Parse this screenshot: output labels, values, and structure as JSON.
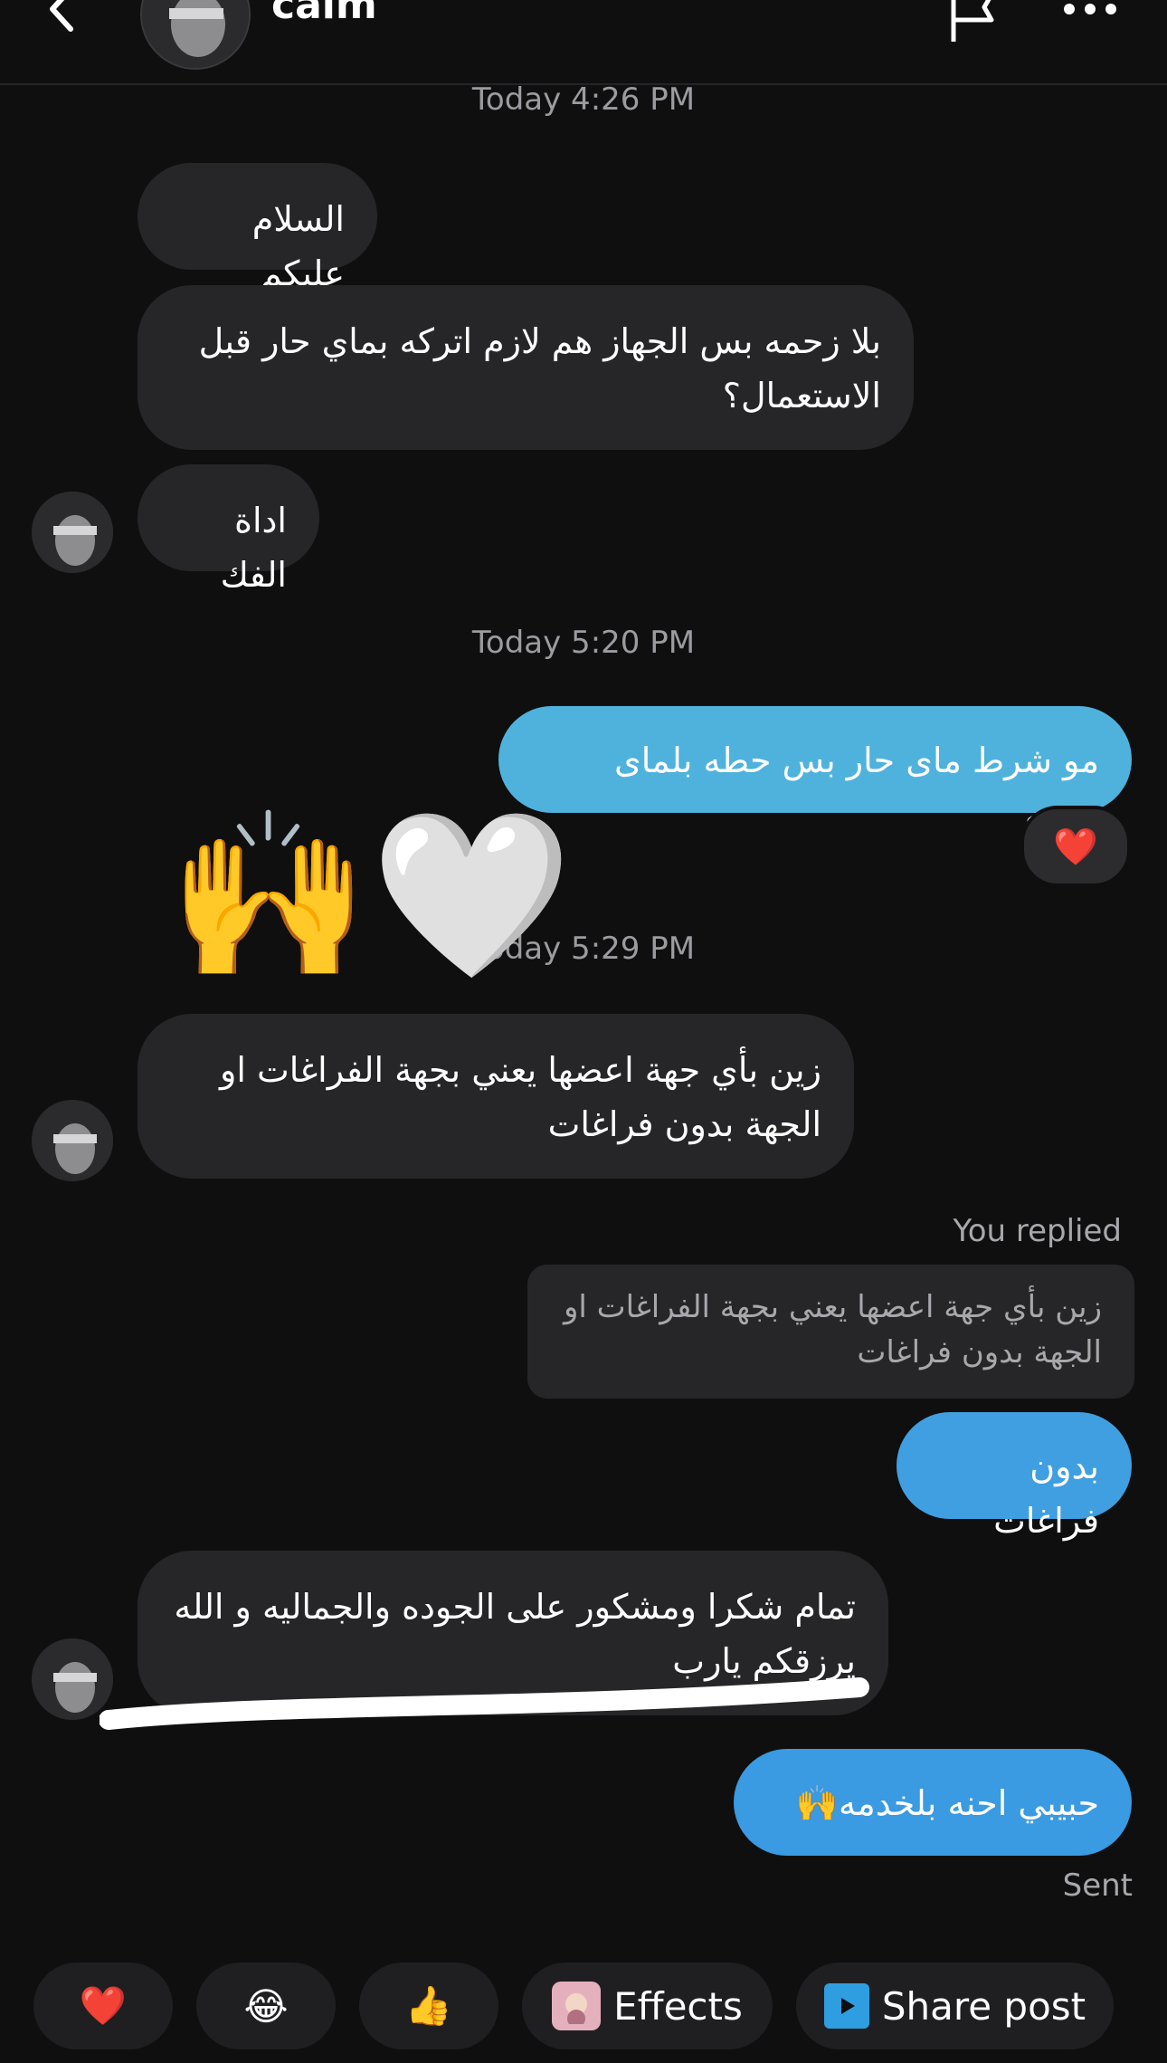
{
  "header": {
    "contact_name": "calm"
  },
  "timestamps": {
    "t1": "Today 4:26 PM",
    "t2": "Today 5:20 PM",
    "t3": "Today 5:29 PM"
  },
  "messages": {
    "m1": "السلام عليكم",
    "m2": "بلا زحمه بس الجهاز هم لازم اتركه بماي حار قبل الاستعمال؟",
    "m3": "اداة الفك",
    "m4": "مو شرط ماى حار بس حطه بلماى شويه",
    "m5": "زين بأي جهة اعضها يعني بجهة الفراغات او الجهة بدون فراغات",
    "m6": "بدون فراغات",
    "m7": "تمام شكرا ومشكور على الجوده والجماليه و الله يرزقكم يارب",
    "m8": "حبيبي احنه بلخدمه🙌"
  },
  "reaction_emoji": "❤️",
  "overlay_emojis": "🙌🤍",
  "you_replied_label": "You replied",
  "reply_quote_text": "زين بأي جهة اعضها يعني بجهة الفراغات او الجهة بدون فراغات",
  "sent_label": "Sent",
  "quick_actions": {
    "heart": "❤️",
    "laugh": "😂",
    "thumbs": "👍",
    "effects_label": "Effects",
    "share_label": "Share post"
  },
  "colors": {
    "background": "#0f0f10",
    "incoming_bubble": "#262628",
    "outgoing_bubble": "#4fb2dd",
    "outgoing_bubble_dark": "#3a9ae2"
  }
}
